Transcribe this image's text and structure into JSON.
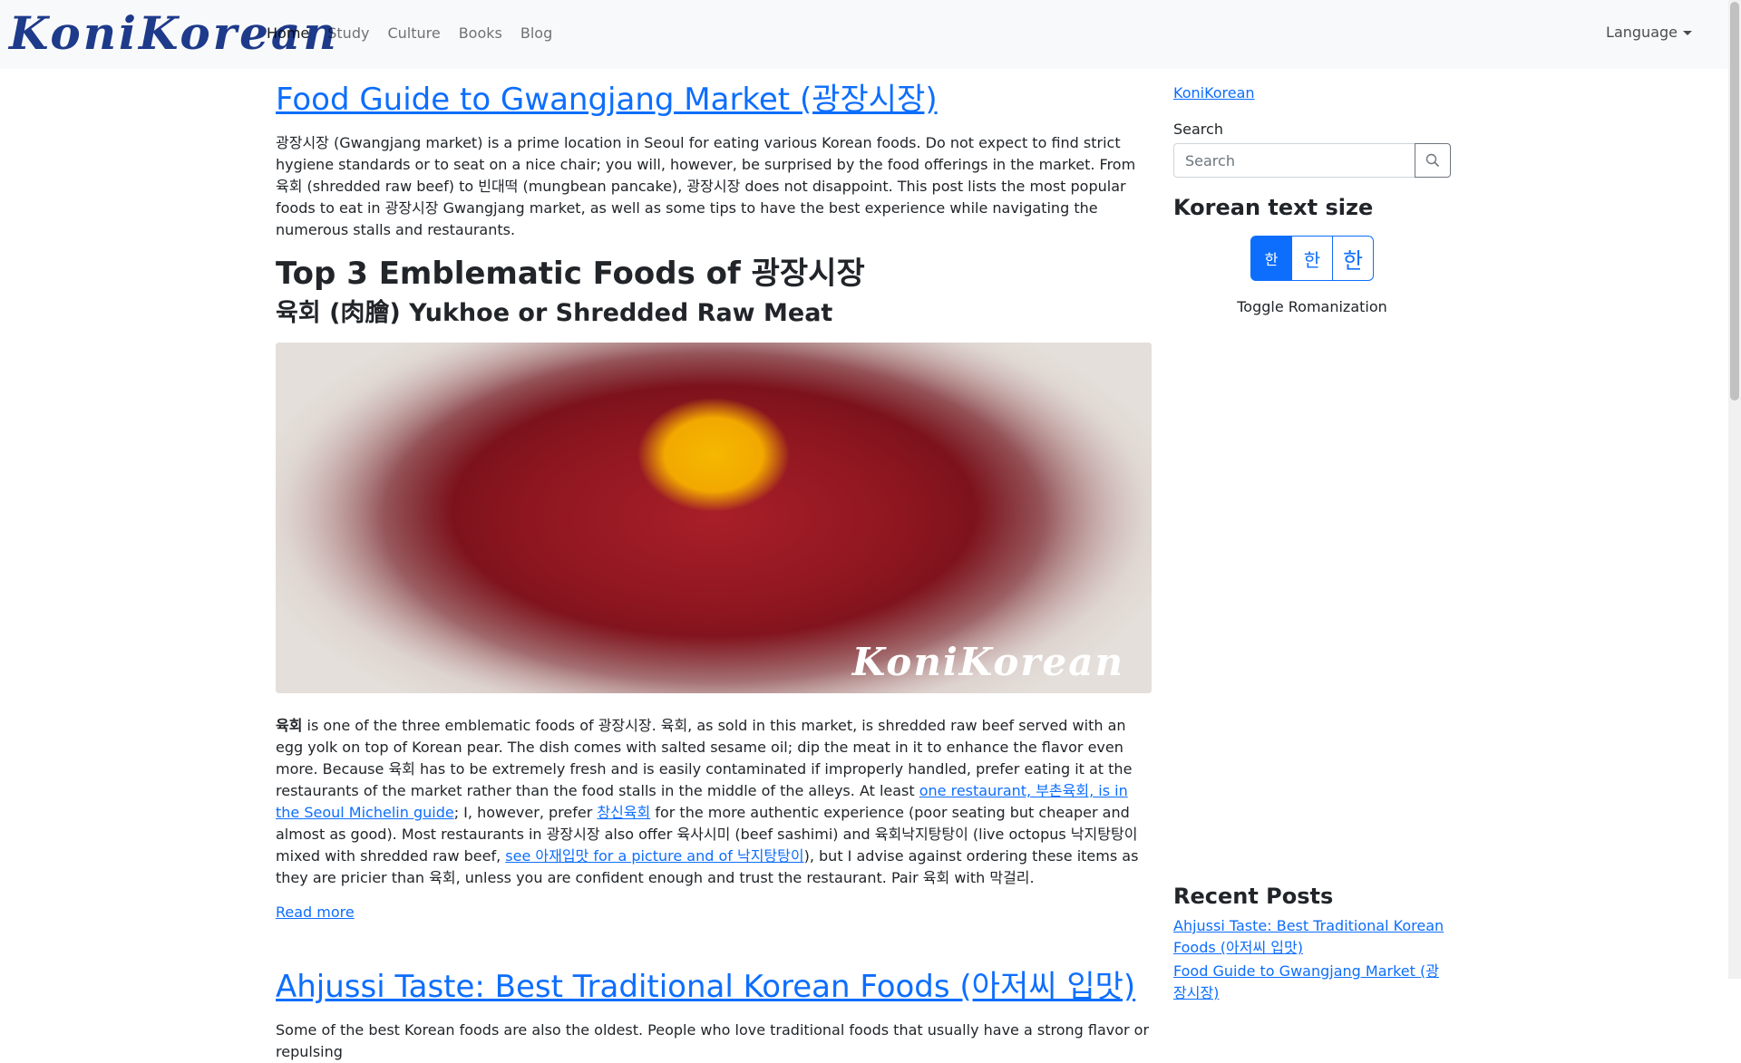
{
  "brand": {
    "logo_text": "KoniKorean"
  },
  "nav": {
    "links": [
      "Home",
      "Study",
      "Culture",
      "Books",
      "Blog"
    ],
    "language_label": "Language"
  },
  "posts": [
    {
      "title": "Food Guide to Gwangjang Market (광장시장)",
      "intro": "광장시장 (Gwangjang market) is a prime location in Seoul for eating various Korean foods. Do not expect to find strict hygiene standards or to seat on a nice chair; you will, however, be surprised by the food offerings in the market. From 육회 (shredded raw beef) to 빈대떡 (mungbean pancake), 광장시장 does not disappoint. This post lists the most popular foods to eat in 광장시장 Gwangjang market, as well as some tips to have the best experience while navigating the numerous stalls and restaurants.",
      "h2": "Top 3 Emblematic Foods of 광장시장",
      "h3": "육회 (肉膾) Yukhoe or Shredded Raw Meat",
      "image_watermark": "KoniKorean",
      "body": {
        "bold": "육회",
        "t1": " is one of the three emblematic foods of 광장시장. 육회, as sold in this market, is shredded raw beef served with an egg yolk on top of Korean pear. The dish comes with salted sesame oil; dip the meat in it to enhance the flavor even more. Because 육회 has to be extremely fresh and is easily contaminated if improperly handled, prefer eating it at the restaurants of the market rather than the food stalls in the middle of the alleys. At least ",
        "link1": "one restaurant, 부촌육회, is in the Seoul Michelin guide",
        "t2": "; I, however, prefer ",
        "link2": "창신육회",
        "t3": " for the more authentic experience (poor seating but cheaper and almost as good). Most restaurants in 광장시장 also offer 육사시미 (beef sashimi) and 육회낙지탕탕이 (live octopus 낙지탕탕이 mixed with shredded raw beef, ",
        "link3": "see 아재입맛 for a picture and of 낙지탕탕이",
        "t4": "), but I advise against ordering these items as they are pricier than 육회, unless you are confident enough and trust the restaurant. Pair 육회 with 막걸리."
      },
      "read_more": "Read more"
    },
    {
      "title": "Ahjussi Taste: Best Traditional Korean Foods (아저씨 입맛)",
      "intro": "Some of the best Korean foods are also the oldest. People who love traditional foods that usually have a strong flavor or repulsing"
    }
  ],
  "sidebar": {
    "site_link": "KoniKorean",
    "search_label": "Search",
    "search_placeholder": "Search",
    "text_size_heading": "Korean text size",
    "size_buttons": [
      "한",
      "한",
      "한"
    ],
    "toggle_romanization": "Toggle Romanization",
    "recent_heading": "Recent Posts",
    "recent_posts": [
      "Ahjussi Taste: Best Traditional Korean Foods (아저씨 입맛)",
      "Food Guide to Gwangjang Market (광장시장)"
    ]
  },
  "colors": {
    "link": "#0d6efd",
    "navbar_bg": "#f8f9fa",
    "logo": "#1e3a8a"
  }
}
